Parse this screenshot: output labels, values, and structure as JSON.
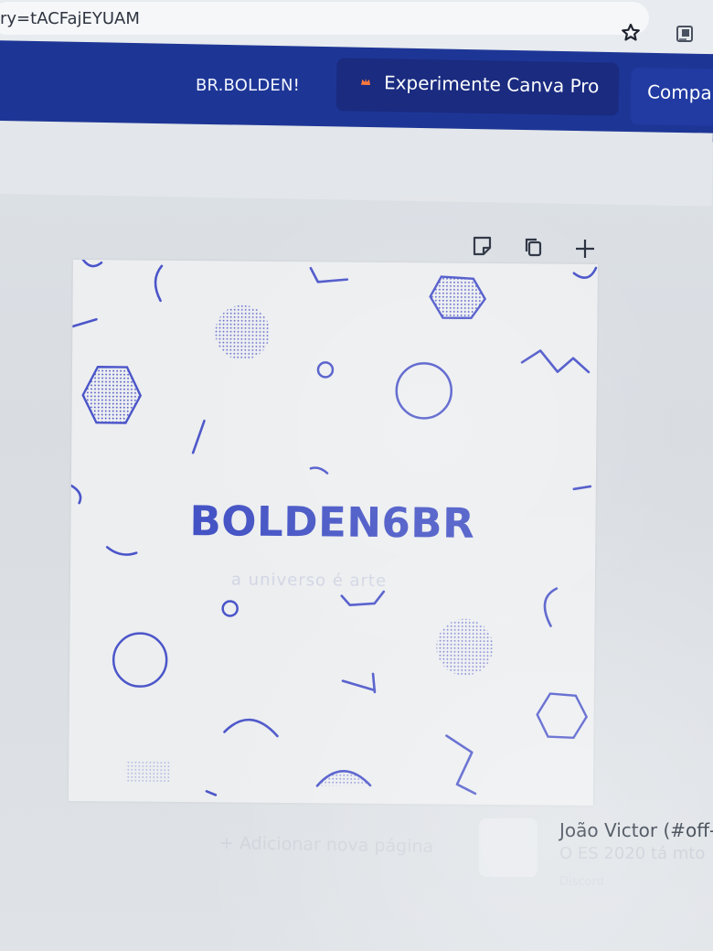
{
  "browser": {
    "url": "ry=tACFajEYUAM",
    "icons": {
      "bookmark": "star-icon",
      "extension": "extension-icon"
    }
  },
  "header": {
    "brand": "BR.BOLDEN!",
    "pro_button": "Experimente Canva Pro",
    "share_button": "Compa"
  },
  "design": {
    "title": "BOLDEN6BR",
    "subtitle": "a universo é arte",
    "accent_color": "#4251c4"
  },
  "editor": {
    "add_page": "+ Adicionar nova página",
    "page_actions": [
      {
        "name": "notes",
        "icon": "note-icon"
      },
      {
        "name": "duplicate",
        "icon": "copy-icon"
      },
      {
        "name": "add",
        "icon": "plus-icon"
      }
    ]
  },
  "notification": {
    "title": "João Victor (#off-",
    "message": "O ES 2020 tá mto",
    "source": "Discord"
  }
}
